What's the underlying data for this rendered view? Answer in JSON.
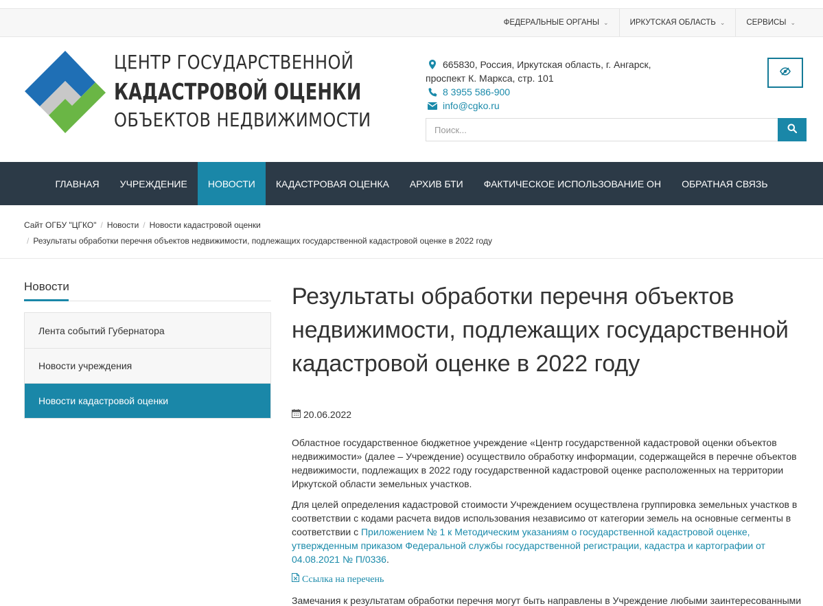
{
  "topbar": {
    "items": [
      {
        "label": "ФЕДЕРАЛЬНЫЕ ОРГАНЫ"
      },
      {
        "label": "ИРКУТСКАЯ ОБЛАСТЬ"
      },
      {
        "label": "СЕРВИСЫ"
      }
    ]
  },
  "logo": {
    "line1": "ЦЕНТР ГОСУДАРСТВЕННОЙ",
    "line2": "КАДАСТРОВОЙ ОЦЕНКИ",
    "line3": "ОБЪЕКТОВ НЕДВИЖИМОСТИ",
    "colors": {
      "blue": "#1f6fb5",
      "green": "#6ab645",
      "grey": "#c8c8c8"
    }
  },
  "contacts": {
    "address_line1": "665830, Россия, Иркутская область, г. Ангарск,",
    "address_line2": "проспект К. Маркса, стр. 101",
    "phone": "8 3955 586-900",
    "email": "info@cgko.ru"
  },
  "search": {
    "placeholder": "Поиск..."
  },
  "nav": {
    "items": [
      {
        "label": "ГЛАВНАЯ"
      },
      {
        "label": "УЧРЕЖДЕНИЕ"
      },
      {
        "label": "НОВОСТИ"
      },
      {
        "label": "КАДАСТРОВАЯ ОЦЕНКА"
      },
      {
        "label": "АРХИВ БТИ"
      },
      {
        "label": "ФАКТИЧЕСКОЕ ИСПОЛЬЗОВАНИЕ ОН"
      },
      {
        "label": "ОБРАТНАЯ СВЯЗЬ"
      }
    ],
    "active_index": 2
  },
  "breadcrumbs": [
    "Сайт ОГБУ \"ЦГКО\"",
    "Новости",
    "Новости кадастровой оценки",
    "Результаты обработки перечня объектов недвижимости, подлежащих государственной кадастровой оценке в 2022 году"
  ],
  "sidebar": {
    "title": "Новости",
    "items": [
      {
        "label": "Лента событий Губернатора"
      },
      {
        "label": "Новости учреждения"
      },
      {
        "label": "Новости кадастровой оценки"
      }
    ],
    "active_index": 2
  },
  "article": {
    "title": "Результаты обработки перечня объектов недвижимости, подлежащих государственной кадастровой оценке в 2022 году",
    "date": "20.06.2022",
    "p1": "Областное государственное бюджетное учреждение «Центр государственной кадастровой оценки объектов недвижимости» (далее – Учреждение) осуществило обработку информации, содержащейся в перечне объектов недвижимости, подлежащих в 2022 году государственной кадастровой оценке расположенных на территории Иркутской области земельных участков.",
    "p2_text": "Для целей определения кадастровой стоимости Учреждением осуществлена группировка земельных участков в соответствии с кодами расчета видов использования независимо от категории земель на основные сегменты в соответствии с ",
    "p2_link": "Приложением № 1 к Методическим указаниям о государственной кадастровой оценке, утвержденным приказом Федеральной службы государственной регистрации, кадастра и картографии от 04.08.2021 № П/0336",
    "p2_end": ".",
    "doc_link": "Ссылка на перечень",
    "p3": "Замечания к результатам обработки перечня могут быть направлены в Учреждение любыми заинтересованными"
  },
  "accent_color": "#1a87a8",
  "nav_bg": "#2c3a47"
}
